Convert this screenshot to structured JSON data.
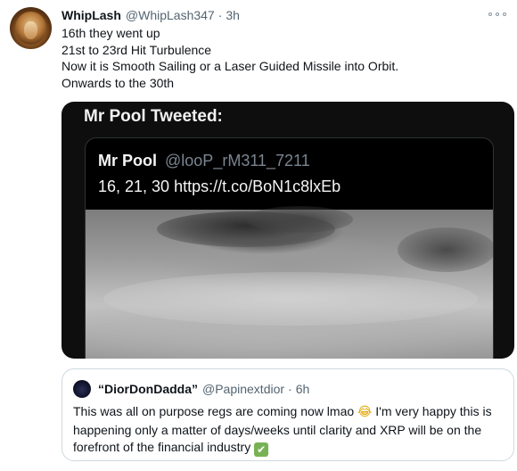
{
  "tweet": {
    "author": {
      "display_name": "WhipLash",
      "handle": "@WhipLash347",
      "separator": "·",
      "time": "3h"
    },
    "more_icon": "more-horizontal-icon",
    "text_lines": [
      "16th they went up",
      "21st to 23rd Hit Turbulence",
      "Now it is Smooth Sailing or a Laser Guided Missile into Orbit.",
      "Onwards to the 30th"
    ],
    "media": {
      "title": "Mr Pool Tweeted:",
      "embedded_tweet": {
        "display_name": "Mr Pool",
        "handle": "@looP_rM311_7211",
        "text": "16, 21, 30 https://t.co/BoN1c8lxEb"
      }
    },
    "quoted_tweet": {
      "display_name": "“DiorDonDadda”",
      "handle": "@Papinextdior",
      "separator": "·",
      "time": "6h",
      "text_part1": "This was all on purpose regs are coming now lmao ",
      "emoji_laugh": "😂",
      "text_part2": " I'm very happy this is happening only a matter of days/weeks until clarity and XRP will be on the forefront of the financial industry ",
      "emoji_check": "✔"
    }
  }
}
